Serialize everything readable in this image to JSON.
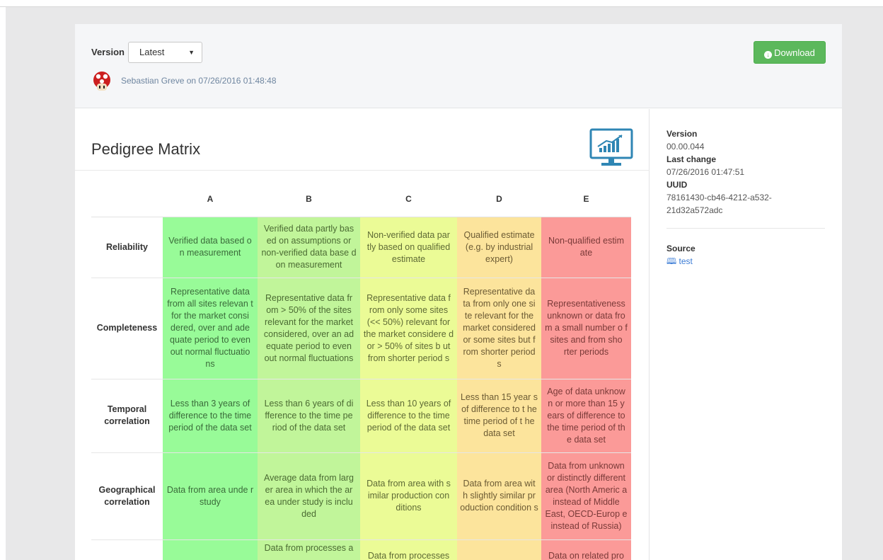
{
  "header": {
    "version_label": "Version",
    "version_selected": "Latest",
    "author": "Sebastian Greve on 07/26/2016 01:48:48",
    "download_label": "Download"
  },
  "main": {
    "title": "Pedigree Matrix",
    "columns": [
      "A",
      "B",
      "C",
      "D",
      "E"
    ],
    "rows": [
      {
        "label": "Reliability",
        "cells": [
          "Verified data based o n measurement",
          "Verified data partly bas ed on assumptions or non-verified data base d on measurement",
          "Non-verified data par tly based on qualified estimate",
          "Qualified estimate (e.g. by industrial expert)",
          "Non-qualified estim ate"
        ]
      },
      {
        "label": "Completeness",
        "cells": [
          "Representative data from all sites relevan t for the market consi dered, over and ade quate period to even out normal fluctuatio ns",
          "Representative data fr om > 50% of the sites relevant for the market considered, over an ad equate period to even out normal fluctuations",
          "Representative data f rom only some sites (<< 50%) relevant for the market considere d or > 50% of sites b ut from shorter period s",
          "Representative da ta from only one si te relevant for the market considered or some sites but f rom shorter period s",
          "Representativeness unknown or data fro m a small number o f sites and from sho rter periods"
        ]
      },
      {
        "label": "Temporal correlation",
        "cells": [
          "Less than 3 years of difference to the time period of the data set",
          "Less than 6 years of di fference to the time pe riod of the data set",
          "Less than 10 years of difference to the time period of the data set",
          "Less than 15 year s of difference to t he time period of t he data set",
          "Age of data unknow n or more than 15 y ears of difference to the time period of th e data set"
        ]
      },
      {
        "label": "Geographical correlation",
        "cells": [
          "Data from area unde r study",
          "Average data from larg er area in which the ar ea under study is inclu ded",
          "Data from area with s imilar production con ditions",
          "Data from area wit h slightly similar pr oduction condition s",
          "Data from unknown or distinctly different area (North Americ a instead of Middle East, OECD-Europ e instead of Russia)"
        ]
      },
      {
        "label": "",
        "cells": [
          "",
          "Data from processes a",
          "Data from processes",
          "",
          "Data on related pro"
        ]
      }
    ]
  },
  "sidebar": {
    "version_label": "Version",
    "version_value": "00.00.044",
    "last_change_label": "Last change",
    "last_change_value": "07/26/2016 01:47:51",
    "uuid_label": "UUID",
    "uuid_value": "78161430-cb46-4212-a532-21d32a572adc",
    "source_label": "Source",
    "source_link": "test"
  }
}
